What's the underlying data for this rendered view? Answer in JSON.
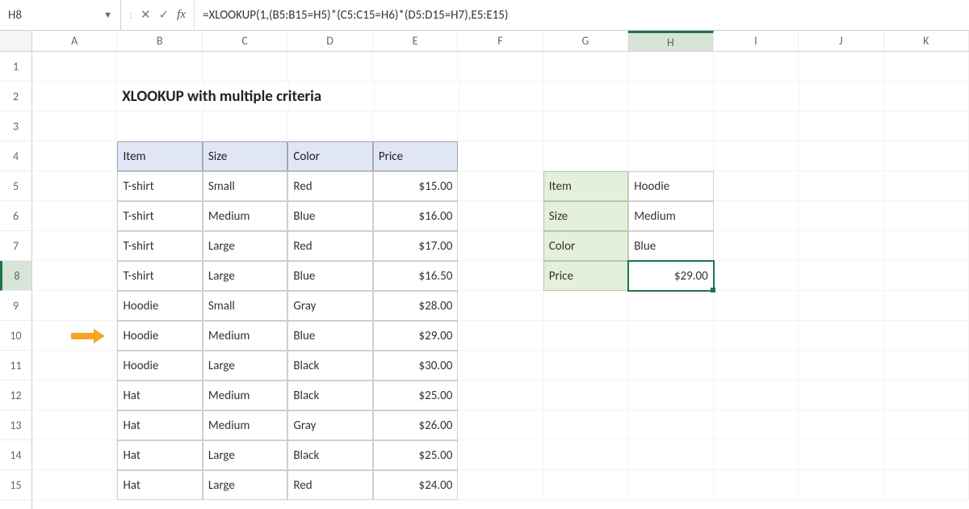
{
  "name_box": "H8",
  "formula": "=XLOOKUP(1,(B5:B15=H5)*(C5:C15=H6)*(D5:D15=H7),E5:E15)",
  "fx_label": "fx",
  "col_headers": [
    "A",
    "B",
    "C",
    "D",
    "E",
    "F",
    "G",
    "H",
    "I",
    "J",
    "K"
  ],
  "row_headers": [
    "1",
    "2",
    "3",
    "4",
    "5",
    "6",
    "7",
    "8",
    "9",
    "10",
    "11",
    "12",
    "13",
    "14",
    "15"
  ],
  "selected": {
    "row": "8",
    "col": "H",
    "cell": "H8"
  },
  "title": "XLOOKUP with multiple criteria",
  "table": {
    "headers": [
      "Item",
      "Size",
      "Color",
      "Price"
    ],
    "rows": [
      {
        "item": "T-shirt",
        "size": "Small",
        "color": "Red",
        "price": "$15.00"
      },
      {
        "item": "T-shirt",
        "size": "Medium",
        "color": "Blue",
        "price": "$16.00"
      },
      {
        "item": "T-shirt",
        "size": "Large",
        "color": "Red",
        "price": "$17.00"
      },
      {
        "item": "T-shirt",
        "size": "Large",
        "color": "Blue",
        "price": "$16.50"
      },
      {
        "item": "Hoodie",
        "size": "Small",
        "color": "Gray",
        "price": "$28.00"
      },
      {
        "item": "Hoodie",
        "size": "Medium",
        "color": "Blue",
        "price": "$29.00"
      },
      {
        "item": "Hoodie",
        "size": "Large",
        "color": "Black",
        "price": "$30.00"
      },
      {
        "item": "Hat",
        "size": "Medium",
        "color": "Black",
        "price": "$25.00"
      },
      {
        "item": "Hat",
        "size": "Medium",
        "color": "Gray",
        "price": "$26.00"
      },
      {
        "item": "Hat",
        "size": "Large",
        "color": "Black",
        "price": "$25.00"
      },
      {
        "item": "Hat",
        "size": "Large",
        "color": "Red",
        "price": "$24.00"
      }
    ]
  },
  "lookup": {
    "labels": [
      "Item",
      "Size",
      "Color",
      "Price"
    ],
    "values": [
      "Hoodie",
      "Medium",
      "Blue",
      "$29.00"
    ]
  },
  "arrow_row": 10
}
